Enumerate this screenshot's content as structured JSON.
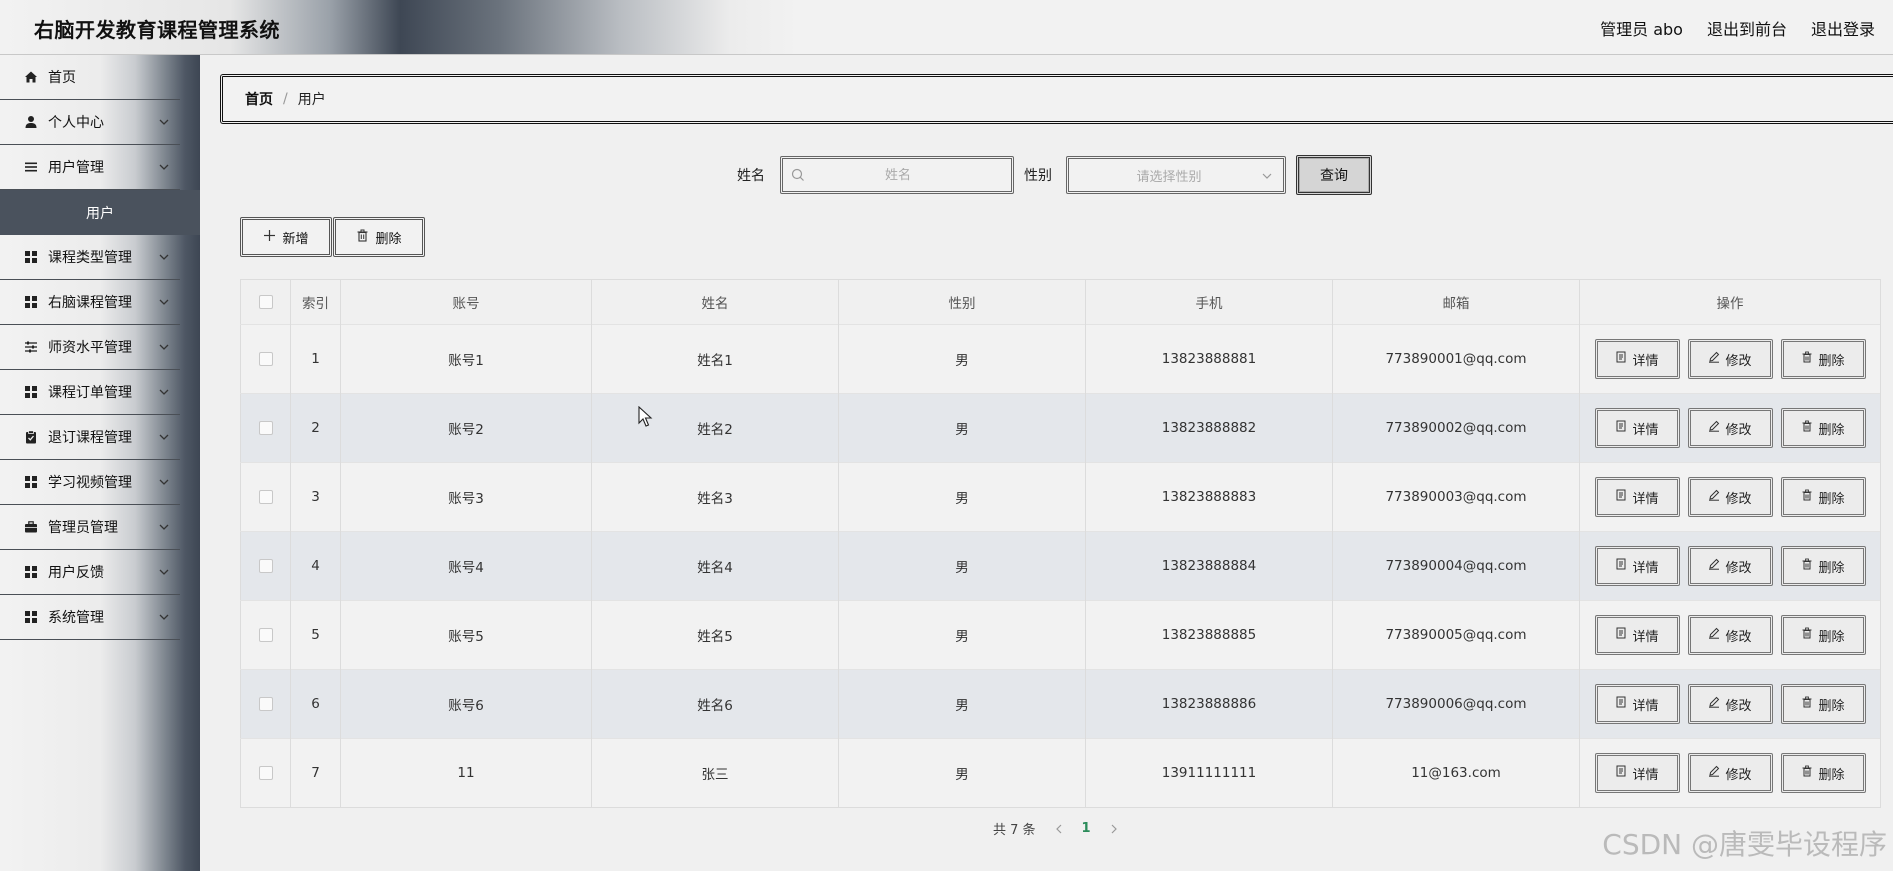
{
  "header": {
    "title": "右脑开发教育课程管理系统",
    "user_label": "管理员 abo",
    "front_label": "退出到前台",
    "logout_label": "退出登录"
  },
  "sidebar": {
    "items": [
      {
        "label": "首页",
        "icon": "home-icon"
      },
      {
        "label": "个人中心",
        "icon": "person-icon"
      },
      {
        "label": "用户管理",
        "icon": "list-icon"
      },
      {
        "label": "课程类型管理",
        "icon": "grid-icon"
      },
      {
        "label": "右脑课程管理",
        "icon": "grid-icon"
      },
      {
        "label": "师资水平管理",
        "icon": "sliders-icon"
      },
      {
        "label": "课程订单管理",
        "icon": "grid-icon"
      },
      {
        "label": "退订课程管理",
        "icon": "clipboard-icon"
      },
      {
        "label": "学习视频管理",
        "icon": "grid-icon"
      },
      {
        "label": "管理员管理",
        "icon": "briefcase-icon"
      },
      {
        "label": "用户反馈",
        "icon": "grid-icon"
      },
      {
        "label": "系统管理",
        "icon": "grid-icon"
      }
    ],
    "sub_item": "用户"
  },
  "breadcrumb": {
    "home": "首页",
    "separator": "/",
    "current": "用户"
  },
  "search": {
    "name_label": "姓名",
    "name_placeholder": "姓名",
    "gender_label": "性别",
    "gender_placeholder": "请选择性别",
    "query_label": "查询"
  },
  "actions": {
    "add_label": "新增",
    "delete_label": "删除"
  },
  "table": {
    "columns": [
      "索引",
      "账号",
      "姓名",
      "性别",
      "手机",
      "邮箱",
      "操作"
    ],
    "rows": [
      {
        "index": "1",
        "account": "账号1",
        "name": "姓名1",
        "gender": "男",
        "phone": "13823888881",
        "email": "773890001@qq.com"
      },
      {
        "index": "2",
        "account": "账号2",
        "name": "姓名2",
        "gender": "男",
        "phone": "13823888882",
        "email": "773890002@qq.com"
      },
      {
        "index": "3",
        "account": "账号3",
        "name": "姓名3",
        "gender": "男",
        "phone": "13823888883",
        "email": "773890003@qq.com"
      },
      {
        "index": "4",
        "account": "账号4",
        "name": "姓名4",
        "gender": "男",
        "phone": "13823888884",
        "email": "773890004@qq.com"
      },
      {
        "index": "5",
        "account": "账号5",
        "name": "姓名5",
        "gender": "男",
        "phone": "13823888885",
        "email": "773890005@qq.com"
      },
      {
        "index": "6",
        "account": "账号6",
        "name": "姓名6",
        "gender": "男",
        "phone": "13823888886",
        "email": "773890006@qq.com"
      },
      {
        "index": "7",
        "account": "11",
        "name": "张三",
        "gender": "男",
        "phone": "13911111111",
        "email": "11@163.com"
      }
    ],
    "ops": {
      "detail": "详情",
      "edit": "修改",
      "delete": "删除"
    }
  },
  "pagination": {
    "total_label": "共 7 条",
    "current_page": "1"
  },
  "watermark": "CSDN @唐雯毕设程序",
  "colors": {
    "sidebar_active": "#4a525d",
    "page_current": "#2b8c5a"
  }
}
